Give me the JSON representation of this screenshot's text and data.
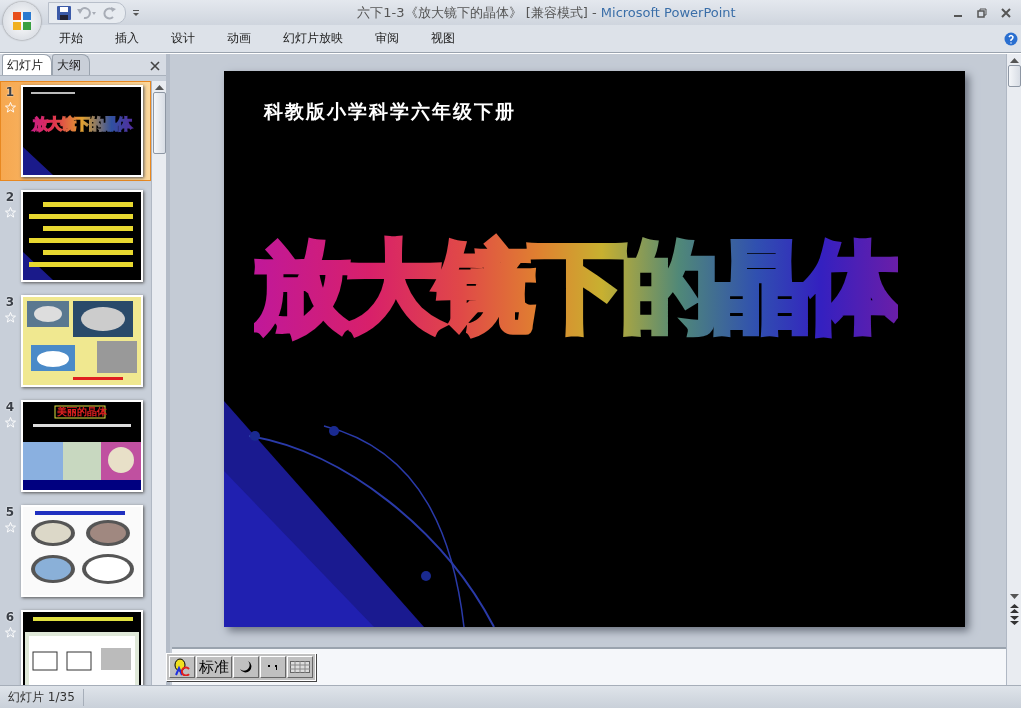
{
  "window": {
    "title": "六下1-3《放大镜下的晶体》 [兼容模式]",
    "separator": "-",
    "app_name": "Microsoft PowerPoint"
  },
  "ribbon_tabs": [
    {
      "label": "开始",
      "selected": false
    },
    {
      "label": "插入",
      "selected": false
    },
    {
      "label": "设计",
      "selected": false
    },
    {
      "label": "动画",
      "selected": false
    },
    {
      "label": "幻灯片放映",
      "selected": false
    },
    {
      "label": "审阅",
      "selected": false
    },
    {
      "label": "视图",
      "selected": false
    }
  ],
  "panel_tabs": [
    {
      "label": "幻灯片",
      "selected": true
    },
    {
      "label": "大纲",
      "selected": false
    }
  ],
  "slides": [
    {
      "number": "1",
      "selected": true,
      "kind": "title",
      "title": "放大镜下的晶体"
    },
    {
      "number": "2",
      "selected": false,
      "kind": "text"
    },
    {
      "number": "3",
      "selected": false,
      "kind": "photos"
    },
    {
      "number": "4",
      "selected": false,
      "kind": "crystals",
      "title": "美丽的晶体"
    },
    {
      "number": "5",
      "selected": false,
      "kind": "dishes"
    },
    {
      "number": "6",
      "selected": false,
      "kind": "boxes"
    }
  ],
  "current_slide": {
    "subtitle": "科教版小学科学六年级下册",
    "title": "放大镜下的晶体"
  },
  "ime_toolbar": {
    "mode": "标准"
  },
  "status_bar": {
    "slide_counter": "幻灯片 1/35"
  }
}
